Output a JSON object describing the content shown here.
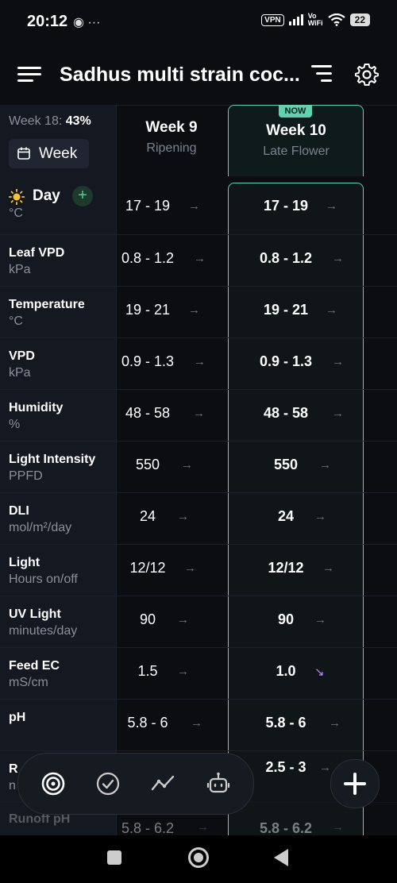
{
  "status": {
    "time": "20:12",
    "left_icons": "◉ ···",
    "vpn": "VPN",
    "vowifi_top": "Vo",
    "vowifi_bottom": "WiFi",
    "battery": "22"
  },
  "header": {
    "title": "Sadhus multi strain coc..."
  },
  "left": {
    "week_info_prefix": "Week 18: ",
    "week_info_pct": "43%",
    "week_button": "Week",
    "day_label": "Day",
    "day_plus": "+"
  },
  "columns": [
    {
      "week": "Week 9",
      "stage": "Ripening"
    },
    {
      "week": "Week 10",
      "stage": "Late Flower",
      "badge": "NOW"
    }
  ],
  "rows": [
    {
      "label": "",
      "unit": "°C",
      "w9": "17 - 19",
      "w9_arrow": "→",
      "w10": "17 - 19",
      "w10_arrow": "→"
    },
    {
      "label": "Leaf VPD",
      "unit": "kPa",
      "w9": "0.8 - 1.2",
      "w9_arrow": "→",
      "w10": "0.8 - 1.2",
      "w10_arrow": "→"
    },
    {
      "label": "Temperature",
      "unit": "°C",
      "w9": "19 - 21",
      "w9_arrow": "→",
      "w10": "19 - 21",
      "w10_arrow": "→"
    },
    {
      "label": "VPD",
      "unit": "kPa",
      "w9": "0.9 - 1.3",
      "w9_arrow": "→",
      "w10": "0.9 - 1.3",
      "w10_arrow": "→"
    },
    {
      "label": "Humidity",
      "unit": "%",
      "w9": "48 - 58",
      "w9_arrow": "→",
      "w10": "48 - 58",
      "w10_arrow": "→"
    },
    {
      "label": "Light Intensity",
      "unit": "PPFD",
      "w9": "550",
      "w9_arrow": "→",
      "w10": "550",
      "w10_arrow": "→"
    },
    {
      "label": "DLI",
      "unit": "mol/m²/day",
      "w9": "24",
      "w9_arrow": "→",
      "w10": "24",
      "w10_arrow": "→"
    },
    {
      "label": "Light",
      "unit": "Hours on/off",
      "w9": "12/12",
      "w9_arrow": "→",
      "w10": "12/12",
      "w10_arrow": "→"
    },
    {
      "label": "UV Light",
      "unit": "minutes/day",
      "w9": "90",
      "w9_arrow": "→",
      "w10": "90",
      "w10_arrow": "→"
    },
    {
      "label": "Feed EC",
      "unit": "mS/cm",
      "w9": "1.5",
      "w9_arrow": "→",
      "w10": "1.0",
      "w10_arrow": "↘"
    },
    {
      "label": "pH",
      "unit": "",
      "w9": "5.8 - 6",
      "w9_arrow": "→",
      "w10": "5.8 - 6",
      "w10_arrow": "→"
    },
    {
      "label": "R",
      "unit": "n",
      "w9": "",
      "w9_arrow": "",
      "w10": "2.5 - 3",
      "w10_arrow": "→"
    },
    {
      "label": "Runoff pH",
      "unit": "",
      "w9": "5.8 - 6.2",
      "w9_arrow": "→",
      "w10": "5.8 - 6.2",
      "w10_arrow": "→"
    }
  ],
  "bottom_nav": {
    "items": [
      "target-icon",
      "check-circle-icon",
      "trend-icon",
      "robot-icon"
    ],
    "fab": "plus-icon"
  },
  "colors": {
    "accent": "#5fd3ae",
    "background": "#0b0d11",
    "down_arrow": "#b28cff"
  }
}
